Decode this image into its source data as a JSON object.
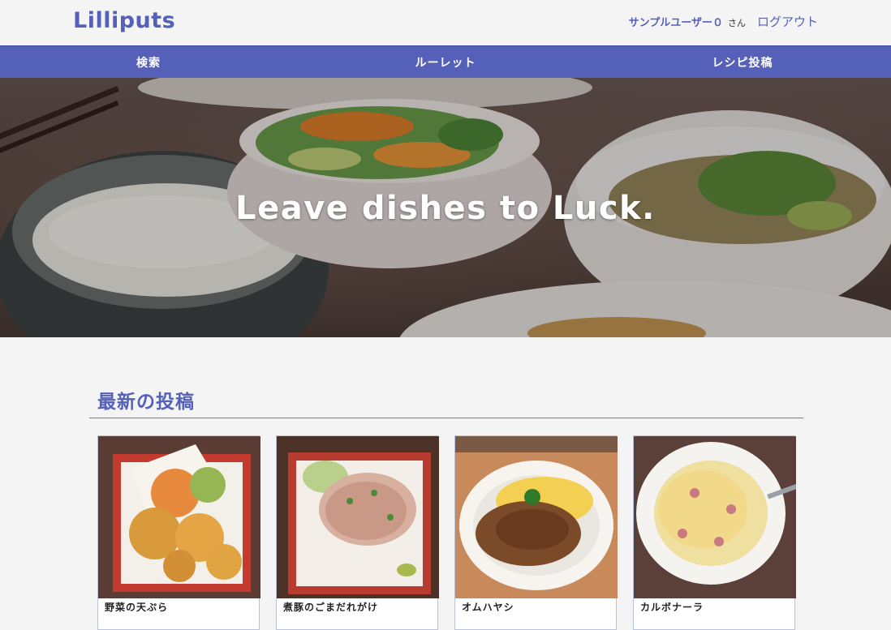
{
  "header": {
    "logo": "Lilliputs",
    "user_name": "サンプルユーザー０",
    "user_suffix": "さん",
    "logout": "ログアウト"
  },
  "nav": {
    "items": [
      {
        "label": "検索"
      },
      {
        "label": "ルーレット"
      },
      {
        "label": "レシピ投稿"
      }
    ]
  },
  "hero": {
    "title": "Leave dishes to Luck."
  },
  "latest": {
    "title": "最新の投稿",
    "posts": [
      {
        "title": "野菜の天ぷら"
      },
      {
        "title": "煮豚のごまだれがけ"
      },
      {
        "title": "オムハヤシ"
      },
      {
        "title": "カルボナーラ"
      }
    ]
  },
  "colors": {
    "brand": "#5560b8",
    "background": "#f4f4f4"
  }
}
